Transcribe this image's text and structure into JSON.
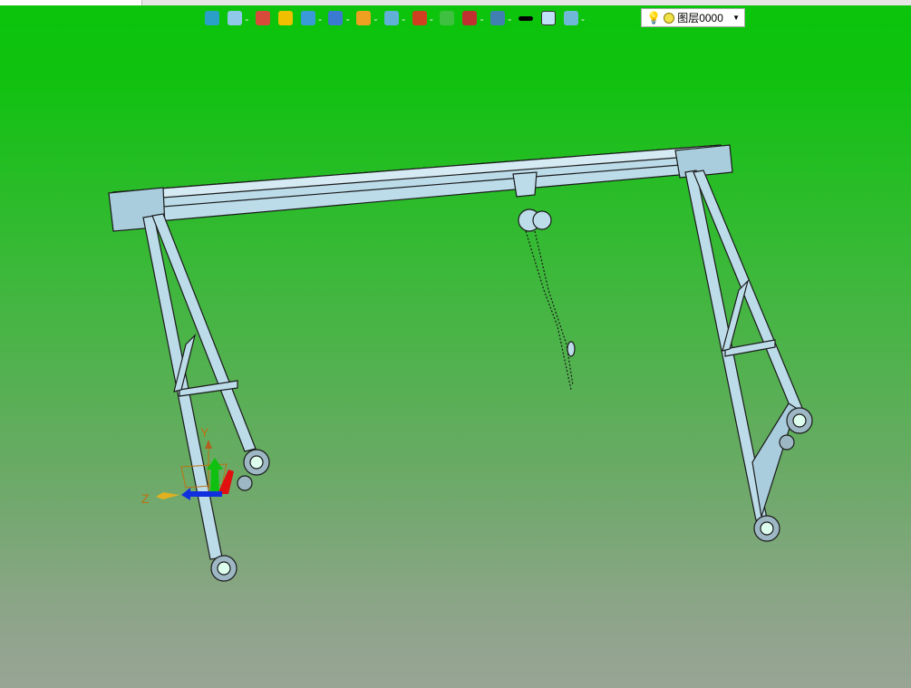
{
  "toolbar": {
    "items": [
      {
        "icon": "exit-sketch-icon",
        "color": "#2aa0c8",
        "dropdown": false
      },
      {
        "icon": "light-bulb-icon",
        "color": "#8fc8e8",
        "dropdown": true
      },
      {
        "icon": "brush-icon",
        "color": "#d84a3a",
        "dropdown": false
      },
      {
        "icon": "sheet-metal-icon",
        "color": "#f0c000",
        "dropdown": false
      },
      {
        "icon": "solid-box-icon",
        "color": "#3a9ad8",
        "dropdown": true
      },
      {
        "icon": "view-cube-icon",
        "color": "#3a7ad0",
        "dropdown": true
      },
      {
        "icon": "render-style-icon",
        "color": "#f0a020",
        "dropdown": true
      },
      {
        "icon": "zoom-fit-icon",
        "color": "#60b0d8",
        "dropdown": true
      },
      {
        "icon": "move-origin-icon",
        "color": "#d04020",
        "dropdown": true
      },
      {
        "icon": "fit-frame-icon",
        "color": "#40c040",
        "dropdown": false
      },
      {
        "icon": "section-icon",
        "color": "#c03030",
        "dropdown": true
      },
      {
        "icon": "display-mode-icon",
        "color": "#4080b0",
        "dropdown": true
      },
      {
        "icon": "line-weight-icon",
        "color": "#000000",
        "dropdown": false
      },
      {
        "icon": "color-swatch-icon",
        "color": "#c0e0f8",
        "dropdown": false
      },
      {
        "icon": "layers-icon",
        "color": "#70b8d8",
        "dropdown": true
      }
    ],
    "layer_select": {
      "value": "图层0000"
    }
  },
  "viewport": {
    "axis_labels": {
      "y": "Y",
      "z": "Z"
    },
    "colors": {
      "frame": "#bcdcea",
      "edge": "#1a1a1a",
      "axis_x": "#e01010",
      "axis_y": "#10c010",
      "axis_z": "#1030e0",
      "axis_label": "#c07010"
    }
  }
}
